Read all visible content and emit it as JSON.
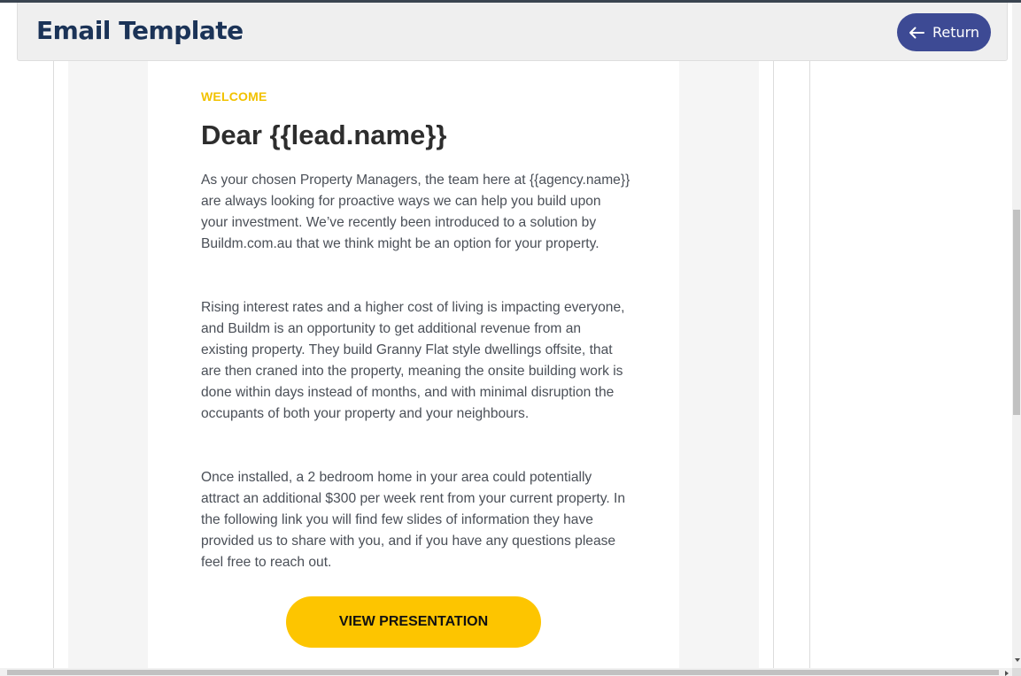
{
  "header": {
    "title": "Email Template",
    "return_label": "Return",
    "return_icon": "arrow-left-icon"
  },
  "email": {
    "eyebrow": "WELCOME",
    "greeting": "Dear {{lead.name}}",
    "paragraphs": [
      "As your chosen Property Managers, the team here at {{agency.name}} are always looking for proactive ways we can help you build upon your investment. We’ve recently been introduced to a solution by Buildm.com.au that we think might be an option for your property.",
      "Rising interest rates and a higher cost of living is impacting everyone, and Buildm is an opportunity to get additional revenue from an existing property. They build Granny Flat style dwellings offsite, that are then craned into the property, meaning the onsite building work is done within days instead of months, and with minimal disruption the occupants of both your property and your neighbours.",
      "Once installed, a 2 bedroom home in your area could potentially attract an additional $300 per week rent from your current property. In the following link you will find few slides of information they have provided us to share with you, and if you have any questions please feel free to reach out."
    ],
    "cta_label": "VIEW PRESENTATION"
  },
  "colors": {
    "title": "#1b3357",
    "return_button": "#3d4a94",
    "eyebrow": "#f2c200",
    "cta": "#fdc500",
    "body_text": "#4a4f57"
  }
}
